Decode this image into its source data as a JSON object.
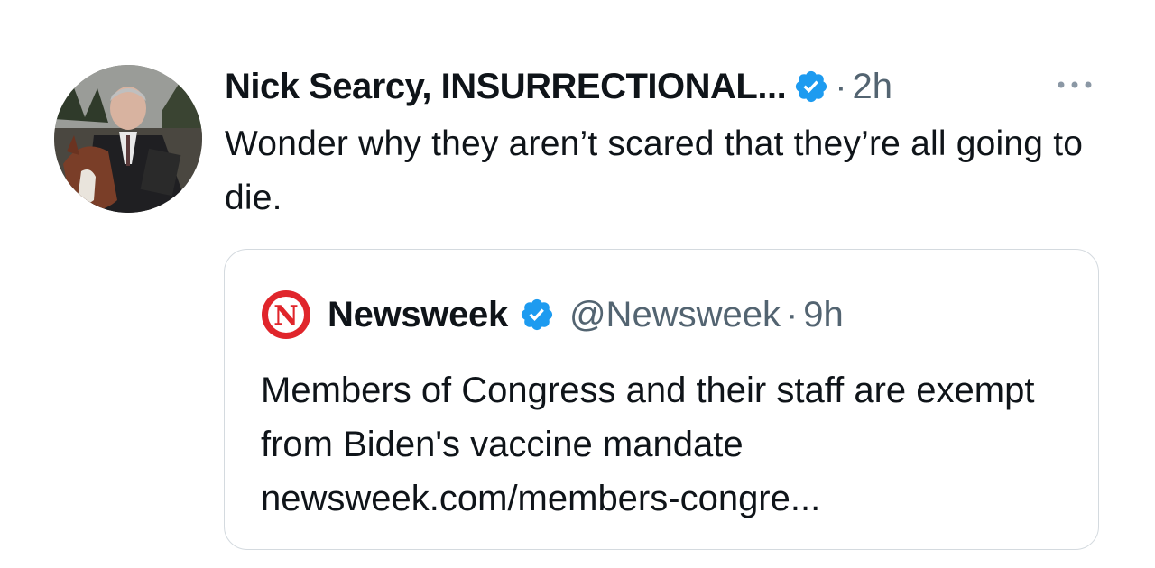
{
  "tweet": {
    "author_name": "Nick Searcy, INSURRECTIONAL...",
    "verified_icon": "verified-badge-icon",
    "dot": "·",
    "time": "2h",
    "more_icon": "more-horizontal-icon",
    "text": "Wonder why they aren’t scared that they’re all going to die."
  },
  "quote": {
    "logo_icon": "newsweek-logo-icon",
    "logo_letter": "N",
    "author_name": "Newsweek",
    "verified_icon": "verified-badge-icon",
    "handle": "@Newsweek",
    "dot": "·",
    "time": "9h",
    "text": "Members of Congress and their staff are exempt from Biden's vaccine mandate",
    "link_text": "newsweek.com/members-congre..."
  },
  "colors": {
    "verified_blue": "#1d9bf0",
    "newsweek_red": "#e0252b",
    "text_primary": "#0f1419",
    "text_secondary": "#536471",
    "border": "#d4dadf"
  }
}
